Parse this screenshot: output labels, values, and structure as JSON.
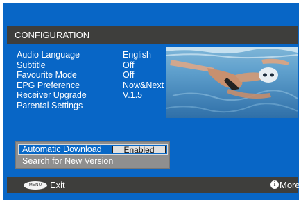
{
  "header": {
    "title": "CONFIGURATION"
  },
  "settings": [
    {
      "label": "Audio Language",
      "value": "English"
    },
    {
      "label": "Subtitle",
      "value": "Off"
    },
    {
      "label": "Favourite Mode",
      "value": "Off"
    },
    {
      "label": "EPG Preference",
      "value": "Now&Next"
    },
    {
      "label": "Receiver Upgrade",
      "value": "V.1.5"
    },
    {
      "label": "Parental Settings",
      "value": ""
    }
  ],
  "submenu": {
    "selected": {
      "label": "Automatic Download",
      "value": "Enabled"
    },
    "items": [
      {
        "label": "Search for New Version"
      }
    ]
  },
  "footer": {
    "menu_key": "MENU",
    "exit_label": "Exit",
    "info_glyph": "i",
    "more_label": "More"
  },
  "colors": {
    "background": "#0866c6",
    "bar": "#3e3e3c",
    "submenu": "#8f8f8f",
    "highlight": "#0868c7"
  },
  "icons": {
    "footer_left": "menu-key-icon",
    "footer_right": "info-icon"
  }
}
